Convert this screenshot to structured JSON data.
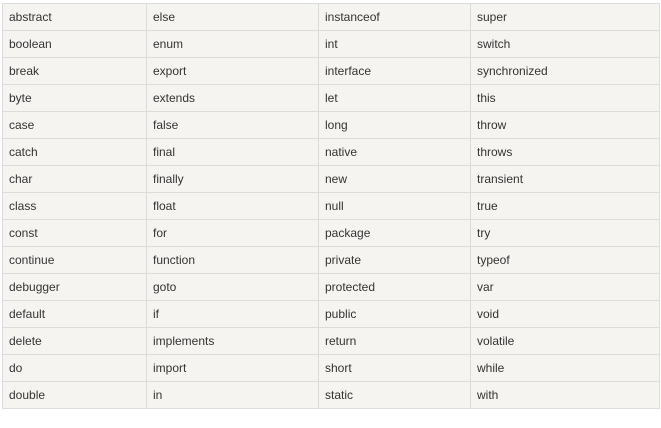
{
  "keyword_table": {
    "rows": [
      [
        "abstract",
        "else",
        "instanceof",
        "super"
      ],
      [
        "boolean",
        "enum",
        "int",
        "switch"
      ],
      [
        "break",
        "export",
        "interface",
        "synchronized"
      ],
      [
        "byte",
        "extends",
        "let",
        "this"
      ],
      [
        "case",
        "false",
        "long",
        "throw"
      ],
      [
        "catch",
        "final",
        "native",
        "throws"
      ],
      [
        "char",
        "finally",
        "new",
        "transient"
      ],
      [
        "class",
        "float",
        "null",
        "true"
      ],
      [
        "const",
        "for",
        "package",
        "try"
      ],
      [
        "continue",
        "function",
        "private",
        "typeof"
      ],
      [
        "debugger",
        "goto",
        "protected",
        "var"
      ],
      [
        "default",
        "if",
        "public",
        "void"
      ],
      [
        "delete",
        "implements",
        "return",
        "volatile"
      ],
      [
        "do",
        "import",
        "short",
        "while"
      ],
      [
        "double",
        "in",
        "static",
        "with"
      ]
    ]
  },
  "colors": {
    "cell_background": "#f6f4f0",
    "border": "#dcdcdc",
    "text": "#333333"
  }
}
